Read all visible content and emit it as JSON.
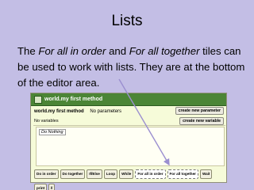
{
  "slide": {
    "title": "Lists",
    "body": {
      "p1": "The ",
      "p2": "For all in order",
      "p3": " and ",
      "p4": "For all together",
      "p5": " tiles can be used to work with lists.  They are at the bottom of the editor area."
    }
  },
  "editor": {
    "tab_label": "world.my first method",
    "method_name": "world.my first method",
    "no_parameters": "No parameters",
    "create_parameter": "create new parameter",
    "no_variables": "No variables",
    "create_variable": "create new variable",
    "do_nothing": "Do Nothing",
    "tiles": [
      "Do in order",
      "Do together",
      "If/Else",
      "Loop",
      "While",
      "For all in order",
      "For all together",
      "Wait",
      "print",
      "//"
    ]
  },
  "colors": {
    "slide_background": "#c3bee5",
    "editor_header": "#4b8536",
    "editor_background": "#f6fbd9",
    "arrow": "#9b8fd0"
  }
}
